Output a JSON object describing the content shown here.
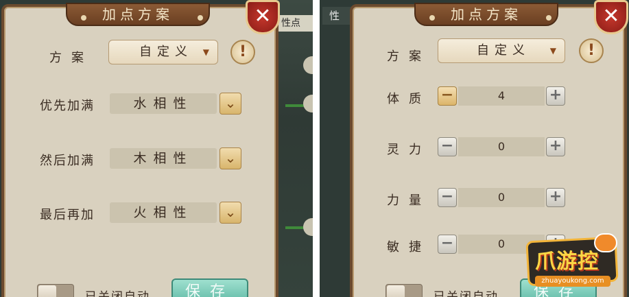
{
  "left_panel": {
    "title": "加点方案",
    "close_label": "✕",
    "scheme_label": "方案",
    "scheme_value": "自定义",
    "info_label": "!",
    "rows": [
      {
        "label": "优先加满",
        "value": "水相性"
      },
      {
        "label": "然后加满",
        "value": "木相性"
      },
      {
        "label": "最后再加",
        "value": "火相性"
      }
    ],
    "auto_label": "已关闭自动",
    "save_label": "保存",
    "bg_tab": "性点"
  },
  "right_panel": {
    "title": "加点方案",
    "close_label": "✕",
    "scheme_label": "方案",
    "scheme_value": "自定义",
    "info_label": "!",
    "stats": [
      {
        "label": "体质",
        "value": "4"
      },
      {
        "label": "灵力",
        "value": "0"
      },
      {
        "label": "力量",
        "value": "0"
      },
      {
        "label": "敏捷",
        "value": "0"
      }
    ],
    "auto_label": "已关闭自动",
    "save_label": "保存",
    "bg_tab": "性"
  },
  "watermark": {
    "text": "爪游控",
    "domain": "zhuayoukong.com"
  }
}
